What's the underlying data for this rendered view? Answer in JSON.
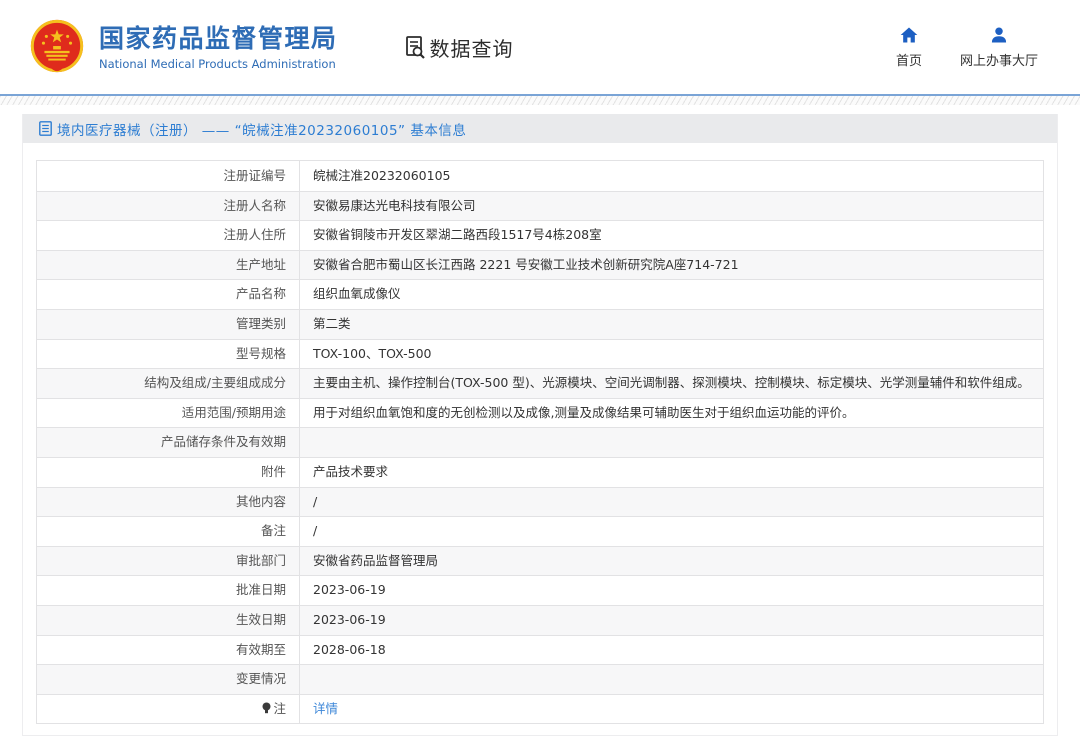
{
  "header": {
    "brand_cn": "国家药品监督管理局",
    "brand_en": "National Medical Products Administration",
    "section": "数据查询",
    "nav": [
      {
        "label": "首页",
        "icon": "home-icon"
      },
      {
        "label": "网上办事大厅",
        "icon": "user-icon"
      }
    ]
  },
  "panel": {
    "title": "境内医疗器械（注册） —— “皖械注准20232060105” 基本信息"
  },
  "table": {
    "rows": [
      {
        "label": "注册证编号",
        "value": "皖械注准20232060105"
      },
      {
        "label": "注册人名称",
        "value": "安徽易康达光电科技有限公司"
      },
      {
        "label": "注册人住所",
        "value": "安徽省铜陵市开发区翠湖二路西段1517号4栋208室"
      },
      {
        "label": "生产地址",
        "value": "安徽省合肥市蜀山区长江西路 2221 号安徽工业技术创新研究院A座714-721"
      },
      {
        "label": "产品名称",
        "value": "组织血氧成像仪"
      },
      {
        "label": "管理类别",
        "value": "第二类"
      },
      {
        "label": "型号规格",
        "value": "TOX-100、TOX-500"
      },
      {
        "label": "结构及组成/主要组成成分",
        "value": "主要由主机、操作控制台(TOX-500 型)、光源模块、空间光调制器、探测模块、控制模块、标定模块、光学测量辅件和软件组成。"
      },
      {
        "label": "适用范围/预期用途",
        "value": "用于对组织血氧饱和度的无创检测以及成像,测量及成像结果可辅助医生对于组织血运功能的评价。"
      },
      {
        "label": "产品储存条件及有效期",
        "value": ""
      },
      {
        "label": "附件",
        "value": "产品技术要求"
      },
      {
        "label": "其他内容",
        "value": "/"
      },
      {
        "label": "备注",
        "value": "/"
      },
      {
        "label": "审批部门",
        "value": "安徽省药品监督管理局"
      },
      {
        "label": "批准日期",
        "value": "2023-06-19"
      },
      {
        "label": "生效日期",
        "value": "2023-06-19"
      },
      {
        "label": "有效期至",
        "value": "2028-06-18"
      },
      {
        "label": "变更情况",
        "value": ""
      },
      {
        "label": "注",
        "value": "详情",
        "link": true,
        "icon": "bulb-icon"
      }
    ]
  },
  "colors": {
    "brand_blue": "#2e6cb5",
    "icon_blue": "#1d5fc2",
    "title_blue": "#2d7dd2",
    "link_blue": "#3d87d8",
    "emblem_red": "#df2b1c",
    "emblem_gold": "#f5c11e",
    "row_alt": "#f7f7f8",
    "border": "#e2e2e4",
    "divider_blue": "#7aa4d6"
  }
}
